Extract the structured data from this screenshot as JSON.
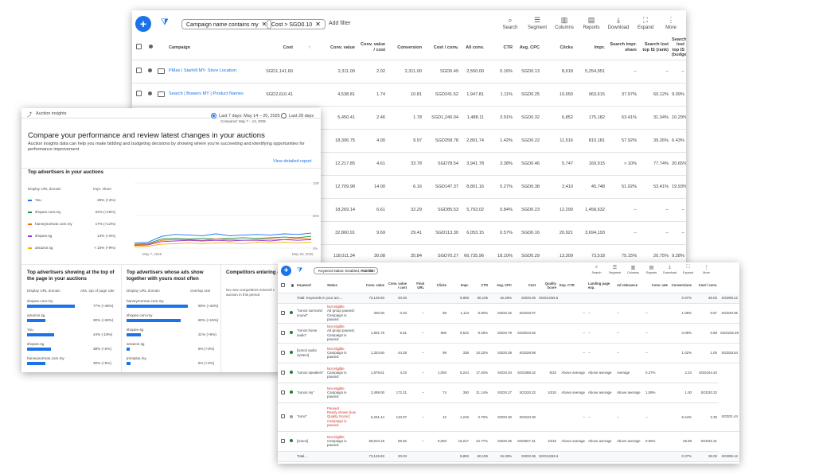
{
  "campaigns_view": {
    "chips": [
      "Campaign name contains my",
      "Cost > SGD0.10"
    ],
    "add_filter": "Add filter",
    "toolbar": [
      "Search",
      "Segment",
      "Columns",
      "Reports",
      "Download",
      "Expand",
      "More"
    ],
    "columns": [
      "Campaign",
      "Cost",
      "Conv. value",
      "Conv. value / cost",
      "Conversion",
      "Cost / conv.",
      "All conv.",
      "CTR",
      "Avg. CPC",
      "Clicks",
      "Impr.",
      "Search impr. share",
      "Search lost top IS (rank)",
      "Search lost top IS (budget)"
    ],
    "rows": [
      [
        "PMax | Starhill MY- Store Location",
        "SGD1,141.60",
        "2,311.00",
        "2.02",
        "2,311.00",
        "SGD0.49",
        "2,550.00",
        "0.16%",
        "SGD0.13",
        "8,618",
        "5,254,951",
        "--",
        "--",
        "--"
      ],
      [
        "Search | Bowers MY | Product Names",
        "SGD2,610.41",
        "4,538.81",
        "1.74",
        "10.81",
        "SGD241.52",
        "1,947.81",
        "1.11%",
        "SGD0.25",
        "10,650",
        "963,615",
        "37.97%",
        "60.12%",
        "9.09%"
      ],
      [
        "Search | Sonos MY | Product Names (TP)",
        "SGD2,213.31",
        "5,450.41",
        "2.46",
        "1.78",
        "SGD1,240.04",
        "1,488.11",
        "3.91%",
        "SGD0.32",
        "6,852",
        "175,182",
        "63.41%",
        "31.34%",
        "10.29%"
      ],
      [
        "",
        "",
        "18,306.75",
        "4.00",
        "9.97",
        "SGD258.78",
        "2,891.74",
        "1.42%",
        "SGD0.22",
        "11,516",
        "810,181",
        "57.92%",
        "39.26%",
        "6.43%"
      ],
      [
        "",
        "",
        "12,217.85",
        "4.61",
        "33.78",
        "SGD78.54",
        "3,941.78",
        "3.38%",
        "SGD0.46",
        "5,747",
        "169,915",
        "> 10%",
        "77.74%",
        "20.65%"
      ],
      [
        "",
        "",
        "12,709.98",
        "14.00",
        "6.16",
        "SGD147.37",
        "8,801.16",
        "5.27%",
        "SGD0.38",
        "2,410",
        "45,748",
        "51.02%",
        "53.41%",
        "19.93%"
      ],
      [
        "",
        "",
        "18,269.14",
        "6.61",
        "32.29",
        "SGD85.53",
        "5,793.02",
        "0.84%",
        "SGD0.23",
        "12,290",
        "1,458,632",
        "--",
        "--",
        "--"
      ],
      [
        "",
        "",
        "32,860.91",
        "9.69",
        "29.41",
        "SGD113.30",
        "6,053.15",
        "0.57%",
        "SGD0.16",
        "20,921",
        "3,694,193",
        "--",
        "--",
        "--"
      ],
      [
        "",
        "",
        "118,011.34",
        "30.08",
        "35.84",
        "SGD70.27",
        "66,735.96",
        "18.10%",
        "SGD0.29",
        "13,309",
        "73,518",
        "75.15%",
        "20.75%",
        "9.28%"
      ],
      [
        "",
        "",
        "135,180.63",
        "17.07",
        "83.40",
        "SGD94.98",
        "132,855.87",
        "0.76%",
        "SGD0.24",
        "32,859",
        "4,297,777",
        "--",
        "--",
        "--"
      ],
      [
        "",
        "",
        "250,863.93",
        "8.36",
        "3,588.76",
        "SGD69.96",
        "268,832.90",
        "0.83%",
        "SGD0.22",
        "187,712",
        "22,663,837",
        "> 10%",
        "70.53%",
        "21.63%"
      ]
    ]
  },
  "auction": {
    "header": "Auction insights",
    "range_a": "Last 7 days: May 14 – 20, 2025",
    "range_a_sub": "Compared: May 7 – 13, 2025",
    "range_b": "Last 28 days",
    "title": "Compare your performance and review latest changes in your auctions",
    "desc": "Auction insights data can help you make bidding and budgeting decisions by showing where you're succeeding and identifying opportunities for performance improvement",
    "link": "View detailed report",
    "top_title": "Top advertisers in your auctions",
    "col_domain": "Display URL domain",
    "col_share": "Impr. share",
    "advertisers": [
      {
        "name": "You",
        "value": "28% (+4%)",
        "color": "#1a73e8"
      },
      {
        "name": "shopee.com.my",
        "value": "22% (+15%)",
        "color": "#1e8e3e"
      },
      {
        "name": "harveynorman.com.my",
        "value": "17% (+12%)",
        "color": "#e8710a"
      },
      {
        "name": "shopee.sg",
        "value": "14% (+3%)",
        "color": "#9334e6"
      },
      {
        "name": "amazon.sg",
        "value": "< 10% (+9%)",
        "color": "#f9ab00"
      }
    ],
    "y_ticks": [
      "100%",
      "50%",
      "0%"
    ],
    "x_ticks": [
      "May 7, 2025",
      "May 20, 2025"
    ],
    "chart_data": {
      "type": "line",
      "x": [
        "May 7",
        "May 8",
        "May 9",
        "May 10",
        "May 11",
        "May 12",
        "May 13",
        "May 14",
        "May 15",
        "May 16",
        "May 17",
        "May 18",
        "May 19",
        "May 20"
      ],
      "ylim": [
        0,
        100
      ],
      "series": [
        {
          "name": "You",
          "color": "#1a73e8",
          "values": [
            8,
            9,
            18,
            21,
            20,
            19,
            22,
            19,
            20,
            21,
            20,
            22,
            21,
            23
          ]
        },
        {
          "name": "shopee.com.my",
          "color": "#1e8e3e",
          "values": [
            6,
            7,
            14,
            15,
            14,
            15,
            14,
            15,
            16,
            15,
            16,
            17,
            16,
            18
          ]
        },
        {
          "name": "harveynorman.com.my",
          "color": "#e8710a",
          "values": [
            5,
            6,
            12,
            13,
            13,
            12,
            14,
            13,
            12,
            13,
            14,
            13,
            15,
            14
          ]
        },
        {
          "name": "shopee.sg",
          "color": "#9334e6",
          "values": [
            4,
            5,
            10,
            11,
            12,
            11,
            12,
            11,
            12,
            12,
            11,
            13,
            12,
            13
          ]
        },
        {
          "name": "amazon.sg",
          "color": "#f9ab00",
          "values": [
            2,
            3,
            6,
            7,
            8,
            7,
            8,
            8,
            7,
            9,
            8,
            9,
            8,
            9
          ]
        }
      ]
    },
    "box1": {
      "title": "Top advertisers showing at the top of the page in your auctions",
      "col_a": "Display URL domain",
      "col_b": "Abs. top of page rate",
      "items": [
        {
          "name": "shopee.com.my",
          "value": "77% (+46%)",
          "pct": 0.77
        },
        {
          "name": "amazon.sg",
          "value": "30% (+28%)",
          "pct": 0.3
        },
        {
          "name": "You",
          "value": "44% (-19%)",
          "pct": 0.44
        },
        {
          "name": "shopee.sg",
          "value": "38% (+2%)",
          "pct": 0.38
        },
        {
          "name": "harveynorman.com.my",
          "value": "30% (+5%)",
          "pct": 0.3
        }
      ]
    },
    "box2": {
      "title": "Top advertisers whose ads show together with yours most often",
      "col_a": "Display URL domain",
      "col_b": "Overlap rate",
      "items": [
        {
          "name": "harveynorman.com.my",
          "value": "90% (+43%)",
          "pct": 0.9
        },
        {
          "name": "shopee.com.my",
          "value": "80% (+15%)",
          "pct": 0.8
        },
        {
          "name": "shopee.sg",
          "value": "21% (+6%)",
          "pct": 0.21
        },
        {
          "name": "amazon.sg",
          "value": "5% (+3%)",
          "pct": 0.05
        },
        {
          "name": "jromplus.my",
          "value": "6% (+4%)",
          "pct": 0.06
        }
      ]
    },
    "box3": {
      "title": "Competitors entering an",
      "empty": "No new competitors entered c auction in this period"
    }
  },
  "keywords_view": {
    "chip": "Keyword status: Enabled, Paused",
    "add_filter": "Add filter",
    "toolbar": [
      "Search",
      "Segment",
      "Columns",
      "Reports",
      "Download",
      "Expand",
      "More"
    ],
    "columns": [
      "Keyword",
      "Status",
      "Conv. value",
      "Conv. value / cost",
      "Final URL",
      "Clicks",
      "Impr.",
      "CTR",
      "Avg. CPC",
      "Cost",
      "Quality Score",
      "Exp. CTR",
      "Landing page exp.",
      "Ad relevance",
      "Conv. rate",
      "Conversions",
      "Cost / conv."
    ],
    "total_label": "Total: Keywords in your acc...",
    "total": [
      "73,125.93",
      "20.03",
      "",
      "9,893",
      "60,105",
      "15.28%",
      "SGD0.36",
      "SGD3,653.61",
      "",
      "",
      "",
      "",
      "0.37%",
      "36.03",
      "SGD99.12"
    ],
    "rows": [
      {
        "kw": "\"sonos surround sound\"",
        "status": "Not eligible",
        "sub": "Ad group paused; Campaign is paused",
        "dot": "g",
        "vals": [
          "330.00",
          "0.33",
          "--",
          "89",
          "1,113",
          "8.00%",
          "SGD0.32",
          "SGD33.07",
          "",
          "--",
          "--",
          "--",
          "--",
          "1.08%",
          "0.57",
          "SGD30.65"
        ]
      },
      {
        "kw": "\"sonos home audio\"",
        "status": "Not eligible",
        "sub": "Ad group paused; Campaign is paused",
        "dot": "g",
        "vals": [
          "1,831.79",
          "5.61",
          "--",
          "806",
          "9,522",
          "8.46%",
          "SGD0.79",
          "SGD634.92",
          "",
          "--",
          "--",
          "--",
          "--",
          "0.08%",
          "0.68",
          "SGD225.39"
        ]
      },
      {
        "kw": "[sonos audio system]",
        "status": "Not eligible",
        "sub": "Campaign is paused",
        "dot": "g",
        "vals": [
          "1,334.50",
          "44.28",
          "--",
          "99",
          "338",
          "10.22%",
          "SGD0.39",
          "SGD28.98",
          "",
          "--",
          "--",
          "--",
          "--",
          "1.02%",
          "1.00",
          "SGD28.64"
        ]
      },
      {
        "kw": "\"sonos speakers\"",
        "status": "Not eligible",
        "sub": "Campaign is paused",
        "dot": "g",
        "vals": [
          "1,579.61",
          "4.23",
          "--",
          "1,093",
          "6,244",
          "17.40%",
          "SGD0.34",
          "SGD368.32",
          "5/10",
          "Above average",
          "Above average",
          "Average",
          "0.27%",
          "2.24",
          "SGD164.43"
        ]
      },
      {
        "kw": "\"sonos my\"",
        "status": "Not eligible",
        "sub": "Campaign is paused",
        "dot": "g",
        "vals": [
          "3,499.00",
          "172.21",
          "--",
          "74",
          "350",
          "21.14%",
          "SGD0.27",
          "SGD20.32",
          "10/10",
          "Above average",
          "Above average",
          "Above average",
          "1.08%",
          "1.00",
          "SGD20.32"
        ]
      },
      {
        "kw": "\"sono\"",
        "status": "Paused",
        "sub": "Rarely shown (low Quality Score); Campaign is paused",
        "dot": "gr",
        "vals": [
          "6,231.44",
          "143.07",
          "--",
          "42",
          "1,215",
          "3.70%",
          "SGD0.30",
          "SGD43.30",
          "",
          "--",
          "--",
          "--",
          "--",
          "6.44%",
          "2.30",
          "SGD21.44"
        ]
      },
      {
        "kw": "[sonos]",
        "status": "Not eligible",
        "sub": "Campaign is paused",
        "dot": "g",
        "vals": [
          "58,910.19",
          "59.92",
          "--",
          "8,093",
          "16,017",
          "24.77%",
          "SGD0.36",
          "SGD827.31",
          "10/10",
          "Above average",
          "Above average",
          "Above average",
          "0.66%",
          "26.69",
          "SGD32.31"
        ]
      }
    ],
    "footer_label": "Total...",
    "footer": [
      "73,125.93",
      "20.03",
      "",
      "9,893",
      "60,105",
      "15.28%",
      "SGD0.36",
      "SGD3,653.61",
      "",
      "",
      "",
      "",
      "0.37%",
      "36.03",
      "SGD99.12"
    ]
  }
}
